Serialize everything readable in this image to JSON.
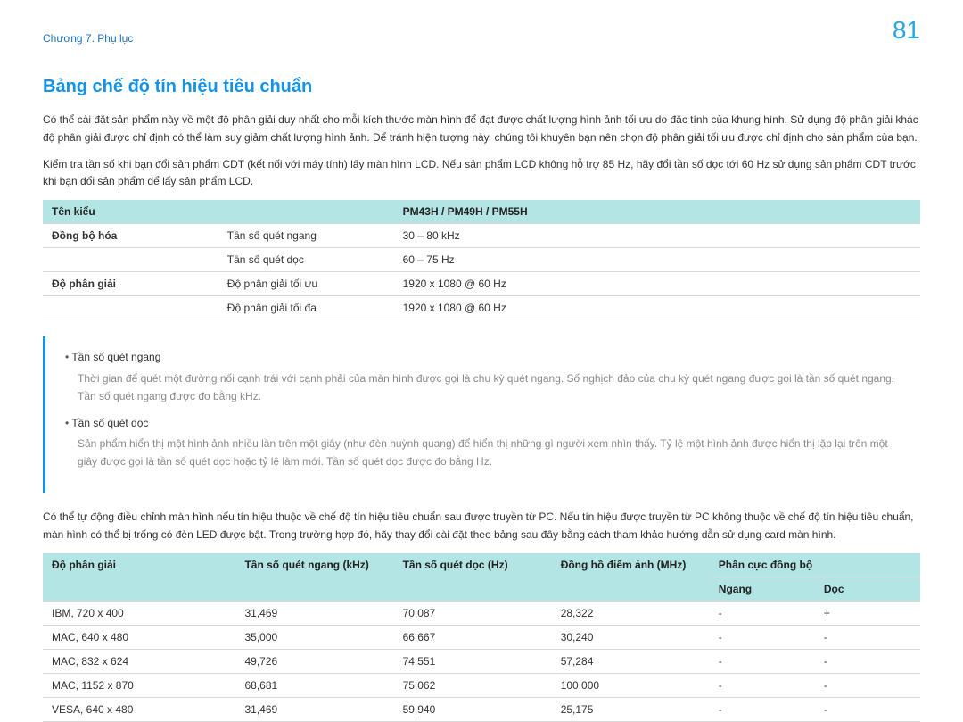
{
  "breadcrumb": "Chương 7. Phụ lục",
  "page_number": "81",
  "title": "Bảng chế độ tín hiệu tiêu chuẩn",
  "para1": "Có thể cài đặt sản phẩm này về một độ phân giải duy nhất cho mỗi kích thước màn hình để đạt được chất lượng hình ảnh tối ưu do đặc tính của khung hình. Sử dụng độ phân giải khác độ phân giải được chỉ định có thể làm suy giảm chất lượng hình ảnh. Để tránh hiện tượng này, chúng tôi khuyên bạn nên chọn độ phân giải tối ưu được chỉ định cho sản phẩm của bạn.",
  "para2": "Kiểm tra tần số khi bạn đổi sản phẩm CDT (kết nối với máy tính) lấy màn hình LCD. Nếu sản phẩm LCD không hỗ trợ 85 Hz, hãy đổi tần số dọc tới 60 Hz sử dụng sản phẩm CDT trước khi bạn đổi sản phẩm để lấy sản phẩm LCD.",
  "table1": {
    "header": {
      "col1": "Tên kiểu",
      "col2": "PM43H / PM49H / PM55H"
    },
    "rows": [
      {
        "group": "Đồng bộ hóa",
        "label": "Tần số quét ngang",
        "value": "30 – 80 kHz"
      },
      {
        "group": "",
        "label": "Tần số quét dọc",
        "value": "60 – 75 Hz"
      },
      {
        "group": "Độ phân giải",
        "label": "Độ phân giải tối ưu",
        "value": "1920 x 1080 @ 60 Hz"
      },
      {
        "group": "",
        "label": "Độ phân giải tối đa",
        "value": "1920 x 1080 @ 60 Hz"
      }
    ]
  },
  "note": {
    "items": [
      {
        "head": "Tần số quét ngang",
        "desc": "Thời gian để quét một đường nối cạnh trái với cạnh phải của màn hình được gọi là chu kỳ quét ngang. Số nghịch đảo của chu kỳ quét ngang được gọi là tần số quét ngang. Tần số quét ngang được đo bằng kHz."
      },
      {
        "head": "Tần số quét dọc",
        "desc": "Sản phẩm hiển thị một hình ảnh nhiều lần trên một giây (như đèn huỳnh quang) để hiển thị những gì người xem nhìn thấy. Tỷ lệ một hình ảnh được hiển thị lặp lại trên một giây được gọi là tần số quét dọc hoặc tỷ lệ làm mới. Tần số quét dọc được đo bằng Hz."
      }
    ]
  },
  "para3": "Có thể tự động điều chỉnh màn hình nếu tín hiệu thuộc về chế độ tín hiệu tiêu chuẩn sau được truyền từ PC. Nếu tín hiệu được truyền từ PC không thuộc về chế độ tín hiệu tiêu chuẩn, màn hình có thể bị trống có đèn LED được bật. Trong trường hợp đó, hãy thay đổi cài đặt theo bảng sau đây bằng cách tham khảo hướng dẫn sử dụng card màn hình.",
  "table2": {
    "header": {
      "res": "Độ phân giải",
      "hf": "Tần số quét ngang (kHz)",
      "vf": "Tần số quét dọc (Hz)",
      "pc": "Đồng hồ điểm ảnh (MHz)",
      "pol": "Phân cực đồng bộ",
      "h": "Ngang",
      "v": "Dọc"
    },
    "rows": [
      {
        "res": "IBM, 720 x 400",
        "hf": "31,469",
        "vf": "70,087",
        "pc": "28,322",
        "h": "-",
        "v": "+"
      },
      {
        "res": "MAC, 640 x 480",
        "hf": "35,000",
        "vf": "66,667",
        "pc": "30,240",
        "h": "-",
        "v": "-"
      },
      {
        "res": "MAC, 832 x 624",
        "hf": "49,726",
        "vf": "74,551",
        "pc": "57,284",
        "h": "-",
        "v": "-"
      },
      {
        "res": "MAC, 1152 x 870",
        "hf": "68,681",
        "vf": "75,062",
        "pc": "100,000",
        "h": "-",
        "v": "-"
      },
      {
        "res": "VESA, 640 x 480",
        "hf": "31,469",
        "vf": "59,940",
        "pc": "25,175",
        "h": "-",
        "v": "-"
      }
    ]
  }
}
